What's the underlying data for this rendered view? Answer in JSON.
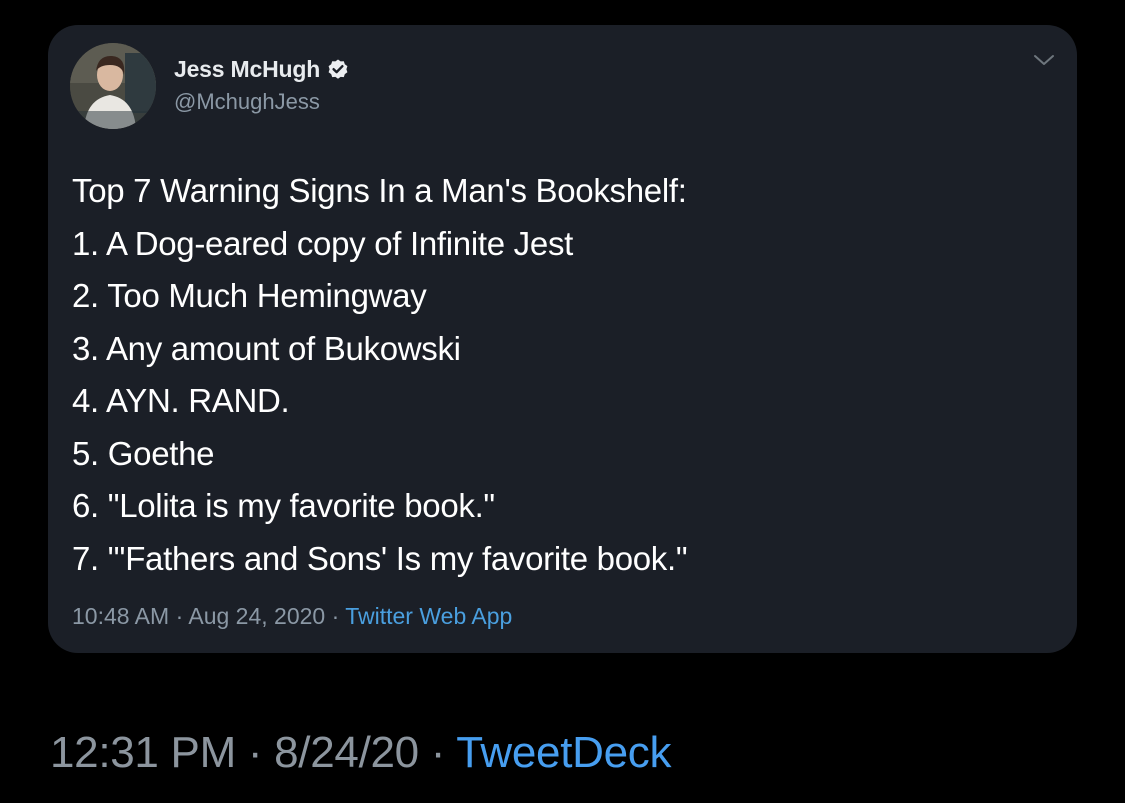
{
  "tweet": {
    "author_name": "Jess McHugh",
    "author_handle": "@MchughJess",
    "lines": [
      "Top 7 Warning Signs In a Man's Bookshelf:",
      "1. A Dog-eared copy of Infinite Jest",
      "2. Too Much Hemingway",
      "3. Any amount of Bukowski",
      "4. AYN. RAND.",
      "5. Goethe",
      "6. \"Lolita is my favorite book.\"",
      "7. \"'Fathers and Sons' Is my favorite book.\""
    ],
    "time": "10:48 AM",
    "date": "Aug 24, 2020",
    "source": "Twitter Web App",
    "separator": " · "
  },
  "footer": {
    "time": "12:31 PM",
    "date": "8/24/20",
    "source": "TweetDeck",
    "separator": " · "
  },
  "icons": {
    "verified": "verified-badge-icon",
    "menu": "chevron-down-icon"
  },
  "colors": {
    "background": "#000000",
    "card": "#1b1f27",
    "primary_text": "#ffffff",
    "secondary_text": "#8b98a5",
    "link": "#4a9fdf"
  }
}
